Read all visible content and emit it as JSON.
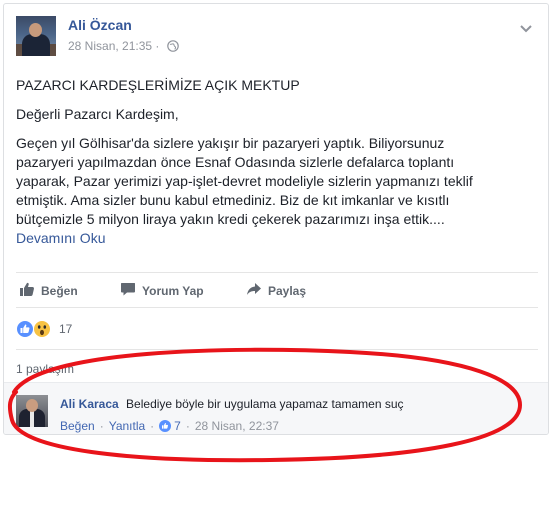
{
  "post": {
    "author": "Ali Özcan",
    "timestamp": "28 Nisan, 21:35",
    "privacy_icon": "globe-icon",
    "title": "PAZARCI KARDEŞLERİMİZE AÇIK MEKTUP",
    "greeting": "Değerli Pazarcı Kardeşim,",
    "body_lines": [
      "Geçen yıl Gölhisar'da sizlere yakışır bir pazaryeri yaptık. Biliyorsunuz",
      "pazaryeri yapılmazdan önce Esnaf Odasında sizlerle defalarca toplantı",
      "yaparak, Pazar yerimizi yap-işlet-devret modeliyle sizlerin yapmanızı teklif",
      "etmiştik. Ama sizler bunu kabul etmediniz. Biz de kıt imkanlar ve kısıtlı",
      "bütçemizle 5 milyon liraya yakın kredi çekerek pazarımızı inşa ettik...."
    ],
    "see_more": "Devamını Oku"
  },
  "actions": {
    "like": "Beğen",
    "comment": "Yorum Yap",
    "share": "Paylaş"
  },
  "reactions": {
    "count": "17",
    "types": [
      "like",
      "wow"
    ]
  },
  "shares": "1 paylaşım",
  "comment": {
    "author": "Ali Karaca",
    "text": "Belediye böyle bir uygulama yapamaz tamamen suç",
    "like": "Beğen",
    "reply": "Yanıtla",
    "likes_count": "7",
    "timestamp": "28 Nisan, 22:37"
  },
  "colors": {
    "link": "#365899",
    "meta": "#90949c",
    "annotation": "#e8141a"
  }
}
